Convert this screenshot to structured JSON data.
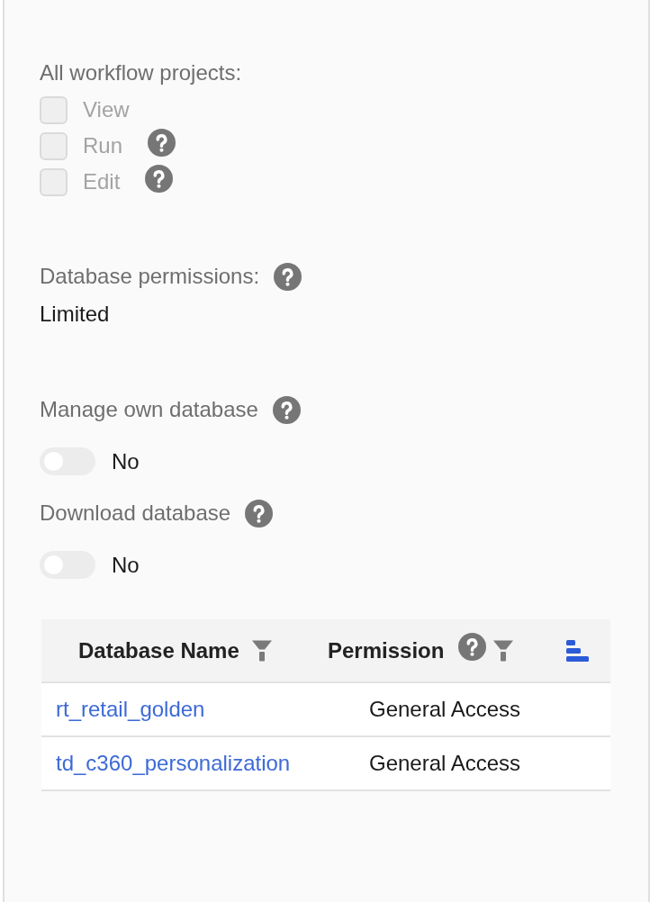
{
  "workflow_projects": {
    "label": "All workflow projects:",
    "options": [
      {
        "label": "View",
        "checked": false,
        "disabled": true,
        "help": false
      },
      {
        "label": "Run",
        "checked": false,
        "disabled": true,
        "help": true
      },
      {
        "label": "Edit",
        "checked": false,
        "disabled": true,
        "help": true
      }
    ]
  },
  "database_permissions": {
    "label": "Database permissions:",
    "help": true,
    "value": "Limited"
  },
  "settings": [
    {
      "label": "Manage own database",
      "help": true,
      "on": false,
      "value": "No"
    },
    {
      "label": "Download database",
      "help": true,
      "on": false,
      "value": "No"
    }
  ],
  "table": {
    "columns": [
      {
        "label": "Database Name",
        "help": false,
        "filter": true
      },
      {
        "label": "Permission",
        "help": true,
        "filter": true
      }
    ],
    "rows": [
      {
        "database_name": "rt_retail_golden",
        "permission": "General Access"
      },
      {
        "database_name": "td_c360_personalization",
        "permission": "General Access"
      }
    ]
  }
}
